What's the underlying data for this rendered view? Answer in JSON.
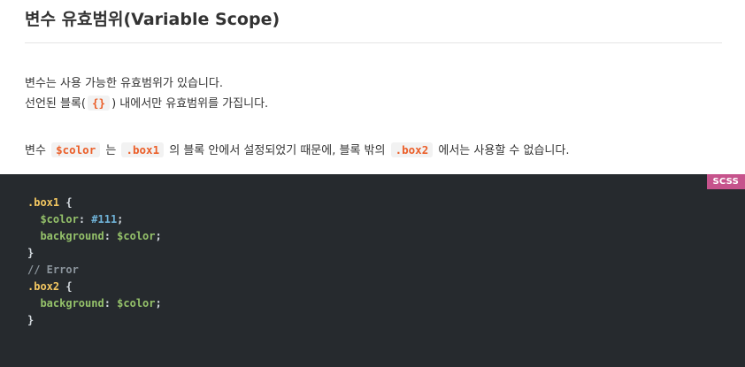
{
  "heading": "변수 유효범위(Variable Scope)",
  "intro": {
    "line1": "변수는 사용 가능한 유효범위가 있습니다.",
    "line2_before": "선언된 블록(",
    "line2_code": "{}",
    "line2_after": ") 내에서만 유효범위를 가집니다."
  },
  "explanation": {
    "t1": "변수",
    "code1": "$color",
    "t2": "는",
    "code2": ".box1",
    "t3": "의 블록 안에서 설정되었기 때문에, 블록 밖의",
    "code3": ".box2",
    "t4": "에서는 사용할 수 없습니다."
  },
  "code_block": {
    "language": "SCSS",
    "lines": {
      "l1_selector": ".box1",
      "l1_brace": " {",
      "l2_indent": "  ",
      "l2_var": "$color",
      "l2_colon": ": ",
      "l2_value": "#111",
      "l2_semi": ";",
      "l3_indent": "  ",
      "l3_prop": "background",
      "l3_colon": ": ",
      "l3_var": "$color",
      "l3_semi": ";",
      "l4_brace": "}",
      "l5_comment": "// Error",
      "l6_selector": ".box2",
      "l6_brace": " {",
      "l7_indent": "  ",
      "l7_prop": "background",
      "l7_colon": ": ",
      "l7_var": "$color",
      "l7_semi": ";",
      "l8_brace": "}"
    }
  },
  "colors": {
    "inline_code_text": "#eb5e28",
    "code_background": "#262a2e",
    "badge_background": "#c6538c",
    "selector": "#f4c861",
    "property": "#95c26a",
    "value": "#6fb3d8",
    "comment": "#8c959d"
  }
}
